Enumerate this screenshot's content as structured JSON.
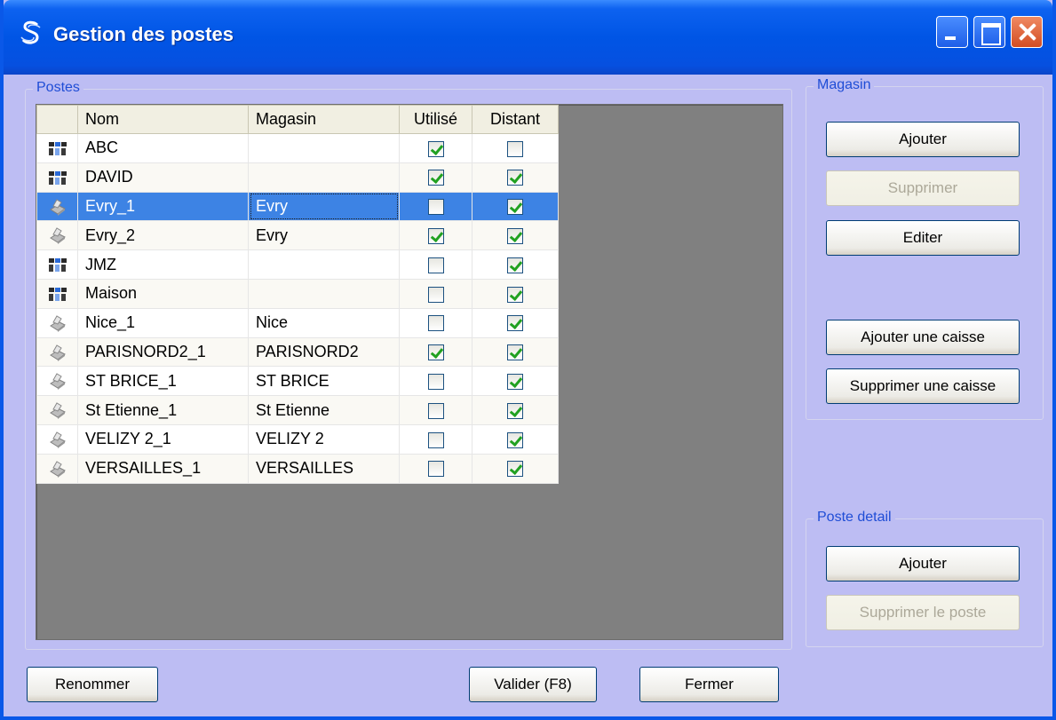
{
  "window": {
    "title": "Gestion des postes"
  },
  "postes": {
    "label": "Postes",
    "columns": [
      "Nom",
      "Magasin",
      "Utilisé",
      "Distant"
    ],
    "rows": [
      {
        "type": "computer",
        "nom": "ABC",
        "magasin": "",
        "utilise": true,
        "distant": false
      },
      {
        "type": "computer",
        "nom": "DAVID",
        "magasin": "",
        "utilise": true,
        "distant": true
      },
      {
        "type": "register",
        "nom": "Evry_1",
        "magasin": "Evry",
        "utilise": false,
        "distant": true,
        "selected": true
      },
      {
        "type": "register",
        "nom": "Evry_2",
        "magasin": "Evry",
        "utilise": true,
        "distant": true
      },
      {
        "type": "computer",
        "nom": "JMZ",
        "magasin": "",
        "utilise": false,
        "distant": true
      },
      {
        "type": "computer",
        "nom": "Maison",
        "magasin": "",
        "utilise": false,
        "distant": true
      },
      {
        "type": "register",
        "nom": "Nice_1",
        "magasin": "Nice",
        "utilise": false,
        "distant": true
      },
      {
        "type": "register",
        "nom": "PARISNORD2_1",
        "magasin": "PARISNORD2",
        "utilise": true,
        "distant": true
      },
      {
        "type": "register",
        "nom": "ST BRICE_1",
        "magasin": "ST BRICE",
        "utilise": false,
        "distant": true
      },
      {
        "type": "register",
        "nom": "St Etienne_1",
        "magasin": "St Etienne",
        "utilise": false,
        "distant": true
      },
      {
        "type": "register",
        "nom": "VELIZY 2_1",
        "magasin": "VELIZY 2",
        "utilise": false,
        "distant": true
      },
      {
        "type": "register",
        "nom": "VERSAILLES_1",
        "magasin": "VERSAILLES",
        "utilise": false,
        "distant": true
      }
    ]
  },
  "magasin": {
    "label": "Magasin",
    "ajouter": "Ajouter",
    "supprimer": "Supprimer",
    "editer": "Editer",
    "ajouter_caisse": "Ajouter une caisse",
    "supprimer_caisse": "Supprimer une caisse"
  },
  "poste_detail": {
    "label": "Poste detail",
    "ajouter": "Ajouter",
    "supprimer_poste": "Supprimer le poste"
  },
  "footer": {
    "renommer": "Renommer",
    "valider": "Valider (F8)",
    "fermer": "Fermer"
  },
  "colors": {
    "titlebar": "#0055e5",
    "selection": "#3d83e4",
    "window_bg": "#bdbdf3",
    "check": "#21a121"
  }
}
